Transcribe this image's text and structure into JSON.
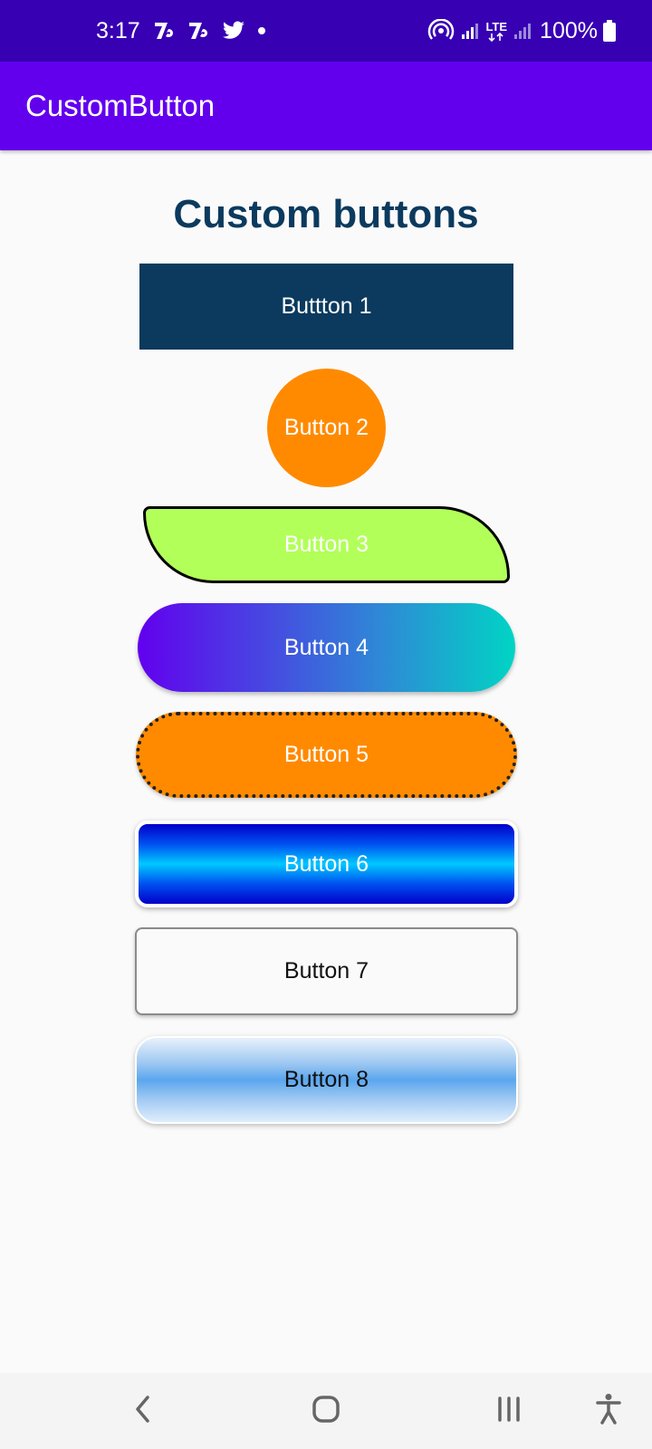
{
  "status_bar": {
    "time": "3:17",
    "battery": "100%",
    "icons_left": [
      "notification-app-icon",
      "notification-app-icon",
      "twitter-icon",
      "dot-icon"
    ],
    "icons_right": [
      "hotspot-icon",
      "signal-icon",
      "lte-icon",
      "signal-icon",
      "battery-icon"
    ],
    "lte_label": "LTE",
    "background": "#3700b3"
  },
  "app_bar": {
    "title": "CustomButton",
    "background": "#6200ee"
  },
  "main": {
    "title": "Custom buttons",
    "title_color": "#0b3a5e",
    "buttons": [
      {
        "label": "Buttton 1",
        "color": "#0b3a5e"
      },
      {
        "label": "Button 2",
        "color": "#ff8a00"
      },
      {
        "label": "Button 3",
        "color": "#b2ff59"
      },
      {
        "label": "Button 4",
        "color_start": "#6200ee",
        "color_end": "#00d4c4"
      },
      {
        "label": "Button 5",
        "color": "#ff8a00"
      },
      {
        "label": "Button 6",
        "color": "#0050f0"
      },
      {
        "label": "Button 7",
        "color": "#fafafa"
      },
      {
        "label": "Button 8",
        "color": "#5aa6ee"
      }
    ]
  },
  "nav_bar": {
    "items": [
      "back-icon",
      "home-icon",
      "recents-icon",
      "accessibility-icon"
    ]
  }
}
